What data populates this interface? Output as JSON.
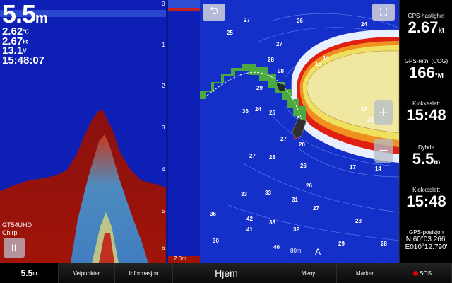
{
  "sonar": {
    "depth_value": "5.5",
    "depth_unit": "m",
    "readouts": [
      {
        "value": "2.62",
        "unit": "°C"
      },
      {
        "value": "2.67",
        "unit": "kt"
      },
      {
        "value": "13.1",
        "unit": "V"
      }
    ],
    "time": "15:48:07",
    "scale_labels": [
      "0",
      "1",
      "2",
      "3",
      "4",
      "5",
      "6"
    ],
    "transducer_line1": "GT54UHD",
    "transducer_line2": "Chirp",
    "pause_label": "II",
    "range_label": "2.0m"
  },
  "map": {
    "back_icon": "back-arrow-icon",
    "fullscreen_icon": "fullscreen-icon",
    "zoom_in_label": "+",
    "zoom_out_label": "−",
    "scale_text": "80m",
    "north_label": "A",
    "soundings": [
      "27",
      "26",
      "25",
      "24",
      "27",
      "14",
      "13",
      "28",
      "28",
      "29",
      "36",
      "24",
      "26",
      "17",
      "27",
      "20",
      "25",
      "27",
      "28",
      "26",
      "17",
      "14",
      "33",
      "42",
      "36",
      "31",
      "41",
      "38",
      "30",
      "32",
      "40",
      "28",
      "29",
      "26",
      "33",
      "27",
      "28"
    ]
  },
  "databar": {
    "fields": [
      {
        "label": "GPS-hastighet",
        "value": "2.67",
        "unit": "kt"
      },
      {
        "label": "GPS-retn. (COG)",
        "value": "166",
        "unit": "°M"
      },
      {
        "label": "Klokkeslett",
        "value": "15:48",
        "unit": ""
      },
      {
        "label": "Dybde",
        "value": "5.5",
        "unit": "m"
      },
      {
        "label": "Klokkeslett",
        "value": "15:48",
        "unit": ""
      }
    ],
    "position": {
      "label": "GPS-posisjon",
      "lat": "N  60°03.266'",
      "lon": "E010°12.790'"
    }
  },
  "bottombar": {
    "depth_value": "5.5",
    "depth_unit": "m",
    "items": [
      "Veipunkter",
      "Informasjon",
      "Hjem",
      "Meny",
      "Marker",
      "SOS"
    ]
  },
  "colors": {
    "sonar_bg": "#0d1fb4",
    "map_water": "#1430c8",
    "land": "#f0e8a0",
    "track": "#4ca840",
    "shallow_red": "#e02010"
  }
}
